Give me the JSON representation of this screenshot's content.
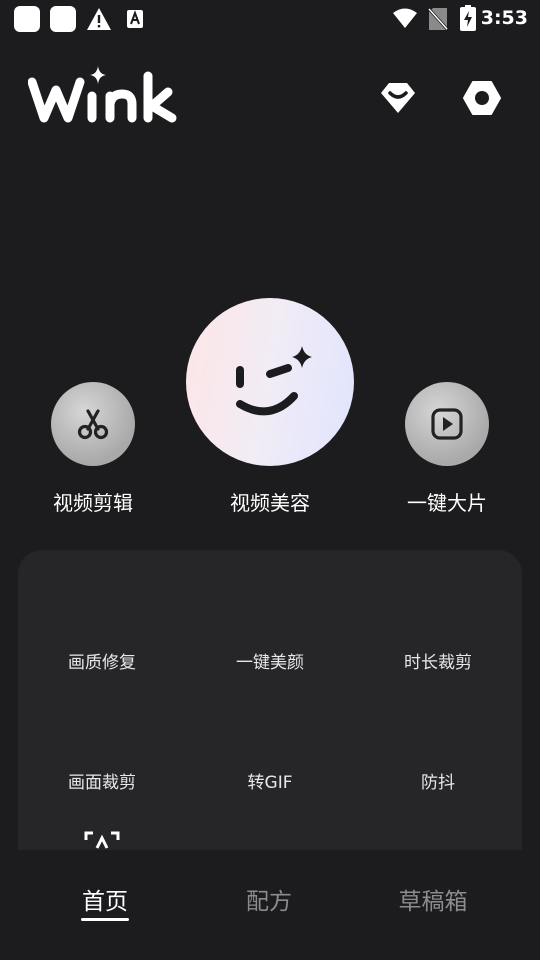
{
  "status_bar": {
    "time": "3:53",
    "icons": [
      "app-icon",
      "app-icon",
      "warning-icon",
      "font-icon",
      "wifi-icon",
      "no-sim-icon",
      "battery-charging-icon"
    ]
  },
  "header": {
    "logo_text": "Wink",
    "icons": [
      "vip-diamond-icon",
      "settings-hexagon-icon"
    ]
  },
  "main_actions": [
    {
      "label": "视频剪辑",
      "icon": "scissors-icon"
    },
    {
      "label": "视频美容",
      "icon": "wink-face-icon"
    },
    {
      "label": "一键大片",
      "icon": "play-icon"
    }
  ],
  "tools": {
    "row1": [
      "画质修复",
      "一键美颜",
      "时长裁剪"
    ],
    "row2": [
      "画面裁剪",
      "转GIF",
      "防抖"
    ]
  },
  "bottom_nav": {
    "tabs": [
      "首页",
      "配方",
      "草稿箱"
    ],
    "active_index": 0
  },
  "colors": {
    "background": "#1c1b1d",
    "panel": "#262629",
    "inactive_tab": "#8c8c8e"
  }
}
